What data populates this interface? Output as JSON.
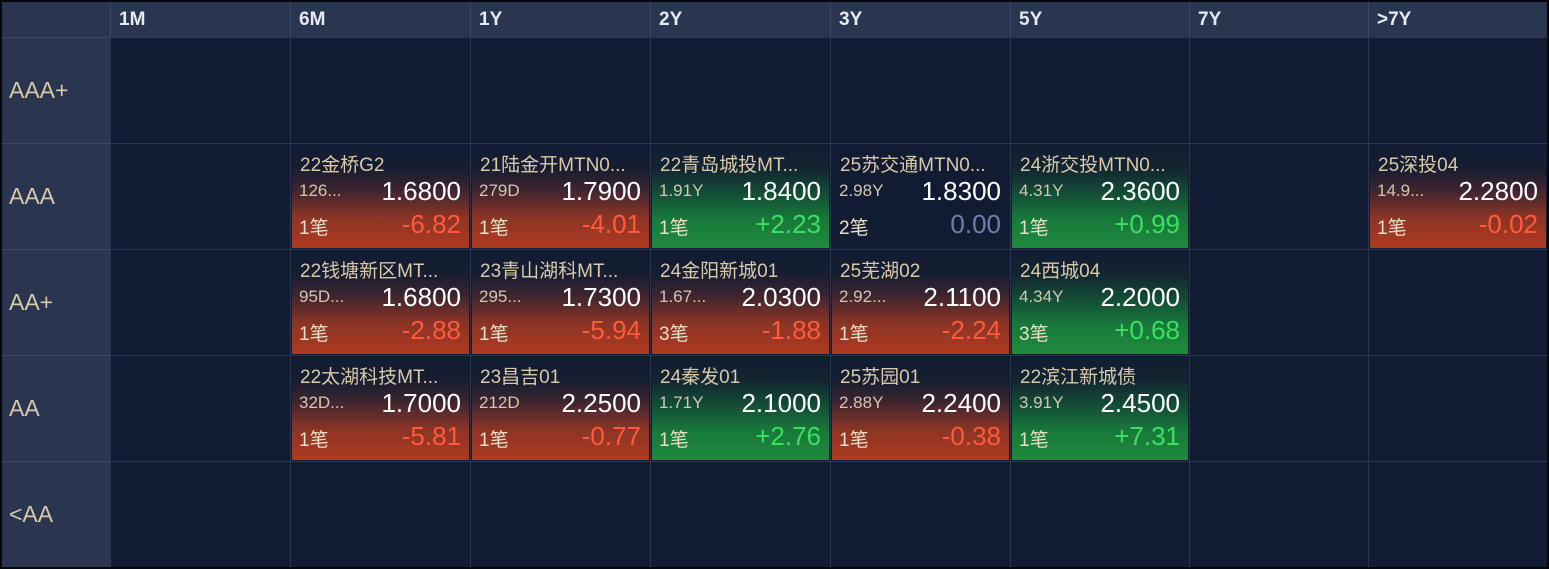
{
  "columns": [
    "1M",
    "6M",
    "1Y",
    "2Y",
    "3Y",
    "5Y",
    "7Y",
    ">7Y"
  ],
  "rows": [
    "AAA+",
    "AAA",
    "AA+",
    "AA",
    "<AA"
  ],
  "colors": {
    "header_bg": "#2a3650",
    "grid_bg": "#111c33",
    "negative": "#ff5a3a",
    "positive": "#3ce060",
    "zero": "#6e7fa8"
  },
  "bonds": [
    {
      "row": 1,
      "col": 1,
      "name": "22金桥G2",
      "tenor": "126...",
      "yield": "1.6800",
      "count": "1笔",
      "change": "-6.82",
      "trend": "red"
    },
    {
      "row": 1,
      "col": 2,
      "name": "21陆金开MTN0...",
      "tenor": "279D",
      "yield": "1.7900",
      "count": "1笔",
      "change": "-4.01",
      "trend": "red"
    },
    {
      "row": 1,
      "col": 3,
      "name": "22青岛城投MT...",
      "tenor": "1.91Y",
      "yield": "1.8400",
      "count": "1笔",
      "change": "+2.23",
      "trend": "green"
    },
    {
      "row": 1,
      "col": 4,
      "name": "25苏交通MTN0...",
      "tenor": "2.98Y",
      "yield": "1.8300",
      "count": "2笔",
      "change": "0.00",
      "trend": "neutral"
    },
    {
      "row": 1,
      "col": 5,
      "name": "24浙交投MTN0...",
      "tenor": "4.31Y",
      "yield": "2.3600",
      "count": "1笔",
      "change": "+0.99",
      "trend": "green"
    },
    {
      "row": 1,
      "col": 7,
      "name": "25深投04",
      "tenor": "14.9...",
      "yield": "2.2800",
      "count": "1笔",
      "change": "-0.02",
      "trend": "red"
    },
    {
      "row": 2,
      "col": 1,
      "name": "22钱塘新区MT...",
      "tenor": "95D...",
      "yield": "1.6800",
      "count": "1笔",
      "change": "-2.88",
      "trend": "red"
    },
    {
      "row": 2,
      "col": 2,
      "name": "23青山湖科MT...",
      "tenor": "295...",
      "yield": "1.7300",
      "count": "1笔",
      "change": "-5.94",
      "trend": "red"
    },
    {
      "row": 2,
      "col": 3,
      "name": "24金阳新城01",
      "tenor": "1.67...",
      "yield": "2.0300",
      "count": "3笔",
      "change": "-1.88",
      "trend": "red"
    },
    {
      "row": 2,
      "col": 4,
      "name": "25芜湖02",
      "tenor": "2.92...",
      "yield": "2.1100",
      "count": "1笔",
      "change": "-2.24",
      "trend": "red"
    },
    {
      "row": 2,
      "col": 5,
      "name": "24西城04",
      "tenor": "4.34Y",
      "yield": "2.2000",
      "count": "3笔",
      "change": "+0.68",
      "trend": "green"
    },
    {
      "row": 3,
      "col": 1,
      "name": "22太湖科技MT...",
      "tenor": "32D...",
      "yield": "1.7000",
      "count": "1笔",
      "change": "-5.81",
      "trend": "red"
    },
    {
      "row": 3,
      "col": 2,
      "name": "23昌吉01",
      "tenor": "212D",
      "yield": "2.2500",
      "count": "1笔",
      "change": "-0.77",
      "trend": "red"
    },
    {
      "row": 3,
      "col": 3,
      "name": "24秦发01",
      "tenor": "1.71Y",
      "yield": "2.1000",
      "count": "1笔",
      "change": "+2.76",
      "trend": "green"
    },
    {
      "row": 3,
      "col": 4,
      "name": "25苏园01",
      "tenor": "2.88Y",
      "yield": "2.2400",
      "count": "1笔",
      "change": "-0.38",
      "trend": "red"
    },
    {
      "row": 3,
      "col": 5,
      "name": "22滨江新城债",
      "tenor": "3.91Y",
      "yield": "2.4500",
      "count": "1笔",
      "change": "+7.31",
      "trend": "green"
    }
  ]
}
